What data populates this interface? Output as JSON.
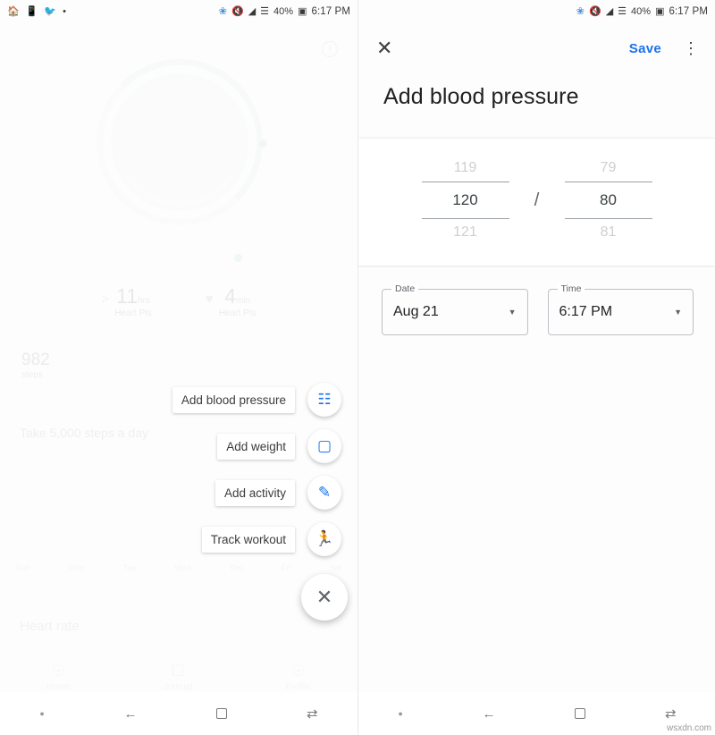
{
  "left": {
    "status_bar": {
      "icons_left": [
        "home-icon",
        "vibrate-icon",
        "twitter-icon",
        "dot-icon"
      ],
      "icons_right": [
        "bluetooth-icon",
        "mute-icon",
        "wifi-icon",
        "signal-icon"
      ],
      "battery": "40%",
      "time": "6:17 PM"
    },
    "info_icon": "!",
    "stats": [
      {
        "glyph": ">",
        "value": "11",
        "unit": "hrs",
        "caption": "Heart Pts"
      },
      {
        "glyph": "♥",
        "value": "4",
        "unit": "min",
        "caption": "Heart Pts"
      }
    ],
    "steps": {
      "value": "982",
      "caption": "steps"
    },
    "goal": "Take 5,000 steps a day",
    "chart_labels": [
      "Sun",
      "Mon",
      "Tue",
      "Wed",
      "Thu",
      "Fri",
      "Sat"
    ],
    "heart_rate_label": "Heart rate",
    "tabs": [
      {
        "icon": "home-icon",
        "label": "Home"
      },
      {
        "icon": "journal-icon",
        "label": "Journal"
      },
      {
        "icon": "profile-icon",
        "label": "Profile"
      }
    ],
    "speed_dial": [
      {
        "label": "Add blood pressure",
        "icon": "blood-pressure-icon",
        "glyph": "☷"
      },
      {
        "label": "Add weight",
        "icon": "scale-icon",
        "glyph": "▢"
      },
      {
        "label": "Add activity",
        "icon": "pencil-icon",
        "glyph": "✎"
      },
      {
        "label": "Track workout",
        "icon": "running-icon",
        "glyph": "🏃"
      }
    ],
    "fab_close": "✕"
  },
  "right": {
    "status_bar": {
      "icons_right": [
        "bluetooth-icon",
        "mute-icon",
        "wifi-icon",
        "signal-icon"
      ],
      "battery": "40%",
      "time": "6:17 PM"
    },
    "close_label": "✕",
    "save_label": "Save",
    "overflow_label": "⋮",
    "title": "Add blood pressure",
    "picker": {
      "systolic": {
        "above": "119",
        "selected": "120",
        "below": "121"
      },
      "separator": "/",
      "diastolic": {
        "above": "79",
        "selected": "80",
        "below": "81"
      }
    },
    "date_field": {
      "label": "Date",
      "value": "Aug 21"
    },
    "time_field": {
      "label": "Time",
      "value": "6:17 PM"
    }
  },
  "navbar": {
    "items": [
      "dot-icon",
      "back-icon",
      "home-square-icon",
      "recents-icon"
    ],
    "back_glyph": "←",
    "recents_glyph": "⇄",
    "dot_glyph": "●"
  },
  "watermark": "wsxdn.com",
  "colors": {
    "accent": "#1a73e8",
    "text": "#202124",
    "muted": "#9aa0a6"
  }
}
